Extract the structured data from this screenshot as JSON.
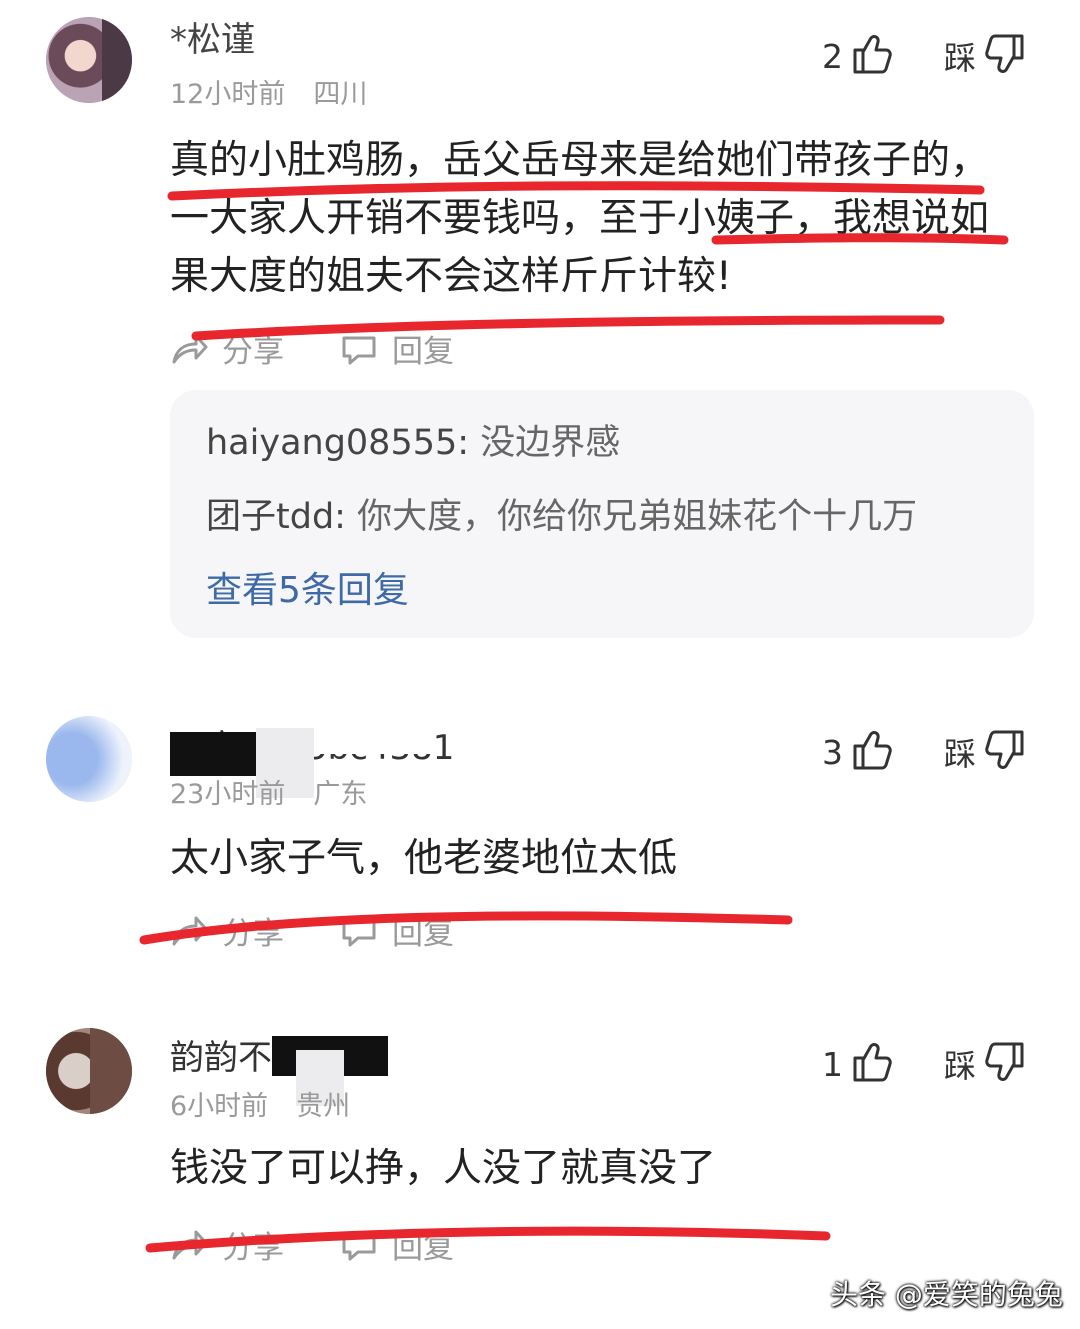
{
  "comments": [
    {
      "username": "*松谨",
      "time": "12小时前",
      "location": "四川",
      "likes": "2",
      "dislike_label": "踩",
      "text": "真的小肚鸡肠，岳父岳母来是给她们带孩子的，一大家人开销不要钱吗，至于小姨子，我想说如果大度的姐夫不会这样斤斤计较!",
      "share_label": "分享",
      "reply_label": "回复",
      "replies": [
        {
          "user": "haiyang08555",
          "text": "没边界感"
        },
        {
          "user": "团子tdd",
          "text": "你大度，你给你兄弟姐妹花个十几万"
        }
      ],
      "more_replies": "查看5条回复"
    },
    {
      "username": "百度用户5bc4381",
      "time": "23小时前",
      "location": "广东",
      "likes": "3",
      "dislike_label": "踩",
      "text": "太小家子气，他老婆地位太低",
      "share_label": "分享",
      "reply_label": "回复"
    },
    {
      "username": "韵韵不咋三言",
      "time": "6小时前",
      "location": "贵州",
      "likes": "1",
      "dislike_label": "踩",
      "text": "钱没了可以挣，人没了就真没了",
      "share_label": "分享",
      "reply_label": "回复"
    }
  ],
  "watermark": "头条 @爱笑的兔兔",
  "colors": {
    "annotation": "#e8262e",
    "link": "#3f6aa8",
    "meta": "#9a9a9a"
  }
}
